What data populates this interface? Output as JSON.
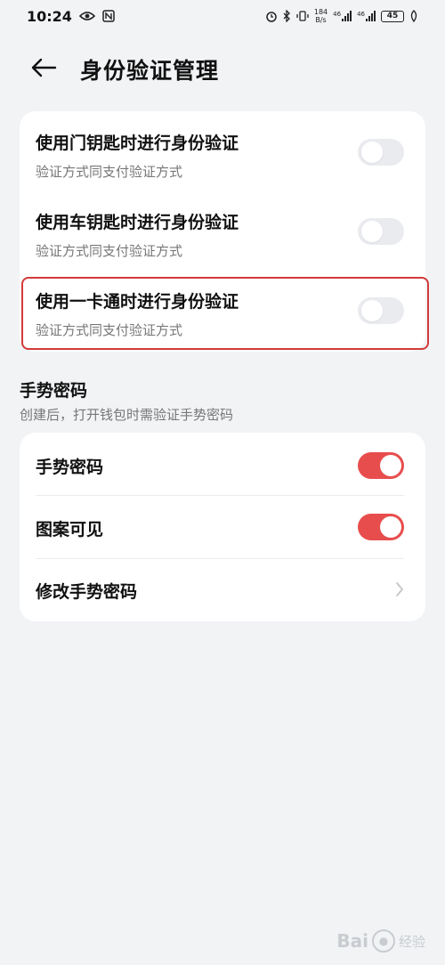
{
  "status_bar": {
    "time": "10:24",
    "network_speed_value": "184",
    "network_speed_unit": "B/s",
    "signal1_label": "46",
    "signal2_label": "46",
    "battery": "45"
  },
  "header": {
    "title": "身份验证管理"
  },
  "verification": {
    "items": [
      {
        "title": "使用门钥匙时进行身份验证",
        "subtitle": "验证方式同支付验证方式",
        "enabled": false
      },
      {
        "title": "使用车钥匙时进行身份验证",
        "subtitle": "验证方式同支付验证方式",
        "enabled": false
      },
      {
        "title": "使用一卡通时进行身份验证",
        "subtitle": "验证方式同支付验证方式",
        "enabled": false
      }
    ]
  },
  "gesture": {
    "section_title": "手势密码",
    "section_subtitle": "创建后，打开钱包时需验证手势密码",
    "items": [
      {
        "title": "手势密码",
        "enabled": true
      },
      {
        "title": "图案可见",
        "enabled": true
      },
      {
        "title": "修改手势密码"
      }
    ]
  },
  "watermark": {
    "brand_a": "Bai",
    "brand_b": "经验"
  },
  "colors": {
    "accent": "#e84d4d",
    "toggle_off": "#e9ebee",
    "highlight": "#d23a3a",
    "background": "#f1f3f5"
  }
}
